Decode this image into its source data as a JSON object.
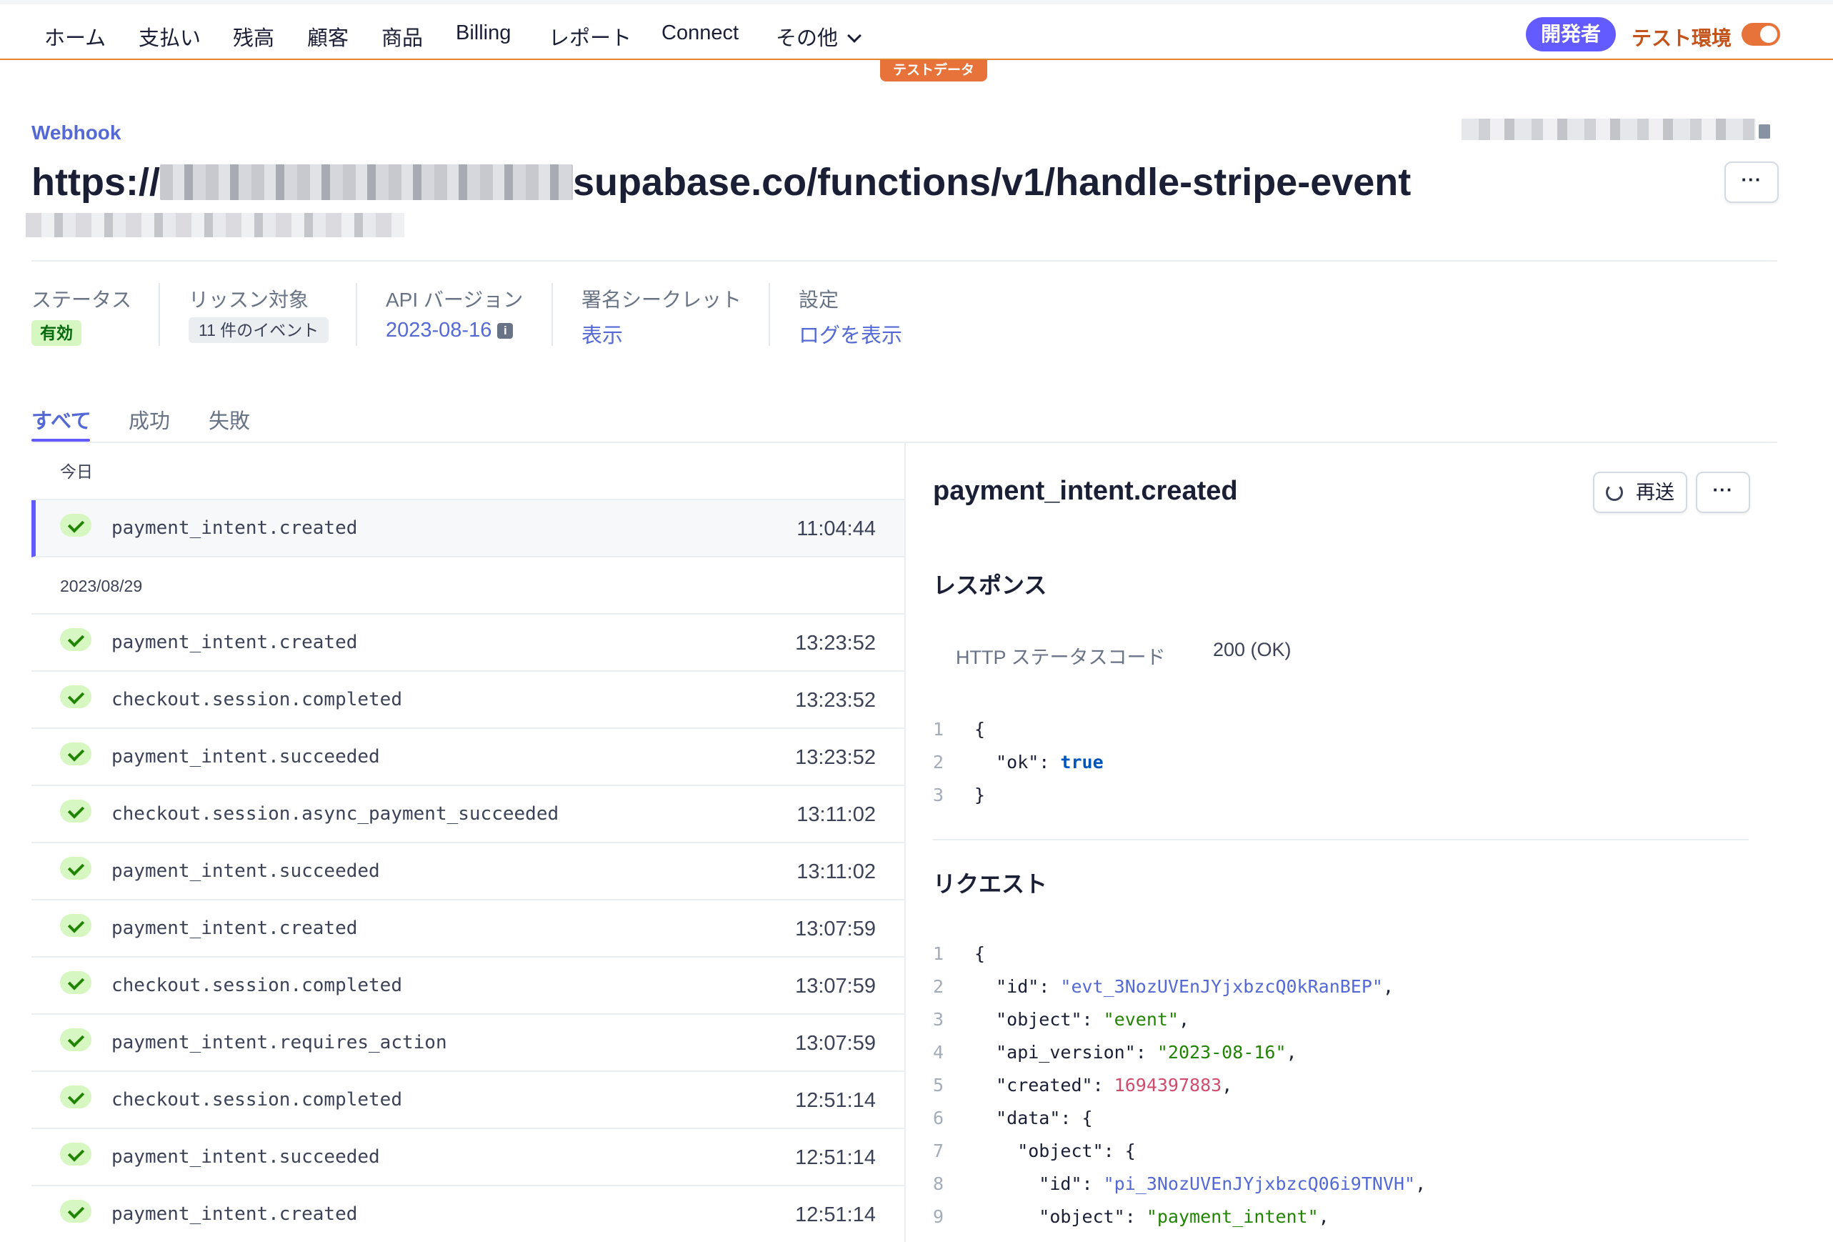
{
  "nav": {
    "items": [
      "ホーム",
      "支払い",
      "残高",
      "顧客",
      "商品",
      "Billing",
      "レポート",
      "Connect",
      "その他"
    ],
    "developer_label": "開発者",
    "test_mode_label": "テスト環境",
    "test_data_badge": "テストデータ"
  },
  "header": {
    "eyebrow": "Webhook",
    "url_prefix": "https://",
    "url_suffix": "supabase.co/functions/v1/handle-stripe-event",
    "more_label": "···"
  },
  "meta": {
    "status_label": "ステータス",
    "status_value": "有効",
    "listen_label": "リッスン対象",
    "listen_value": "11 件のイベント",
    "api_label": "API バージョン",
    "api_value": "2023-08-16",
    "secret_label": "署名シークレット",
    "secret_value": "表示",
    "settings_label": "設定",
    "settings_value": "ログを表示"
  },
  "tabs": [
    {
      "label": "すべて",
      "active": true
    },
    {
      "label": "成功",
      "active": false
    },
    {
      "label": "失敗",
      "active": false
    }
  ],
  "events": {
    "groups": [
      {
        "heading": "今日",
        "rows": [
          {
            "name": "payment_intent.created",
            "time": "11:04:44",
            "selected": true
          }
        ]
      },
      {
        "heading": "2023/08/29",
        "rows": [
          {
            "name": "payment_intent.created",
            "time": "13:23:52"
          },
          {
            "name": "checkout.session.completed",
            "time": "13:23:52"
          },
          {
            "name": "payment_intent.succeeded",
            "time": "13:23:52"
          },
          {
            "name": "checkout.session.async_payment_succeeded",
            "time": "13:11:02"
          },
          {
            "name": "payment_intent.succeeded",
            "time": "13:11:02"
          },
          {
            "name": "payment_intent.created",
            "time": "13:07:59"
          },
          {
            "name": "checkout.session.completed",
            "time": "13:07:59"
          },
          {
            "name": "payment_intent.requires_action",
            "time": "13:07:59"
          },
          {
            "name": "checkout.session.completed",
            "time": "12:51:14"
          },
          {
            "name": "payment_intent.succeeded",
            "time": "12:51:14"
          },
          {
            "name": "payment_intent.created",
            "time": "12:51:14"
          }
        ]
      }
    ]
  },
  "detail": {
    "title": "payment_intent.created",
    "resend_label": "再送",
    "response_heading": "レスポンス",
    "http_status_label": "HTTP ステータスコード",
    "http_status_value": "200 (OK)",
    "request_heading": "リクエスト",
    "response_body": [
      {
        "n": "1",
        "parts": [
          [
            "{",
            "k"
          ]
        ]
      },
      {
        "n": "2",
        "parts": [
          [
            "  \"ok\": ",
            "k"
          ],
          [
            "true",
            "b"
          ]
        ]
      },
      {
        "n": "3",
        "parts": [
          [
            "}",
            "k"
          ]
        ]
      }
    ],
    "request_body": [
      {
        "n": "1",
        "parts": [
          [
            "{",
            "k"
          ]
        ]
      },
      {
        "n": "2",
        "parts": [
          [
            "  \"id\": ",
            "k"
          ],
          [
            "\"evt_3NozUVEnJYjxbzcQ0kRanBEP\"",
            "s"
          ],
          [
            ",",
            "k"
          ]
        ]
      },
      {
        "n": "3",
        "parts": [
          [
            "  \"object\": ",
            "k"
          ],
          [
            "\"event\"",
            "sg"
          ],
          [
            ",",
            "k"
          ]
        ]
      },
      {
        "n": "4",
        "parts": [
          [
            "  \"api_version\": ",
            "k"
          ],
          [
            "\"2023-08-16\"",
            "sg"
          ],
          [
            ",",
            "k"
          ]
        ]
      },
      {
        "n": "5",
        "parts": [
          [
            "  \"created\": ",
            "k"
          ],
          [
            "1694397883",
            "n"
          ],
          [
            ",",
            "k"
          ]
        ]
      },
      {
        "n": "6",
        "parts": [
          [
            "  \"data\": {",
            "k"
          ]
        ]
      },
      {
        "n": "7",
        "parts": [
          [
            "    \"object\": {",
            "k"
          ]
        ]
      },
      {
        "n": "8",
        "parts": [
          [
            "      \"id\": ",
            "k"
          ],
          [
            "\"pi_3NozUVEnJYjxbzcQ06i9TNVH\"",
            "s"
          ],
          [
            ",",
            "k"
          ]
        ]
      },
      {
        "n": "9",
        "parts": [
          [
            "      \"object\": ",
            "k"
          ],
          [
            "\"payment_intent\"",
            "sg"
          ],
          [
            ",",
            "k"
          ]
        ]
      }
    ]
  }
}
